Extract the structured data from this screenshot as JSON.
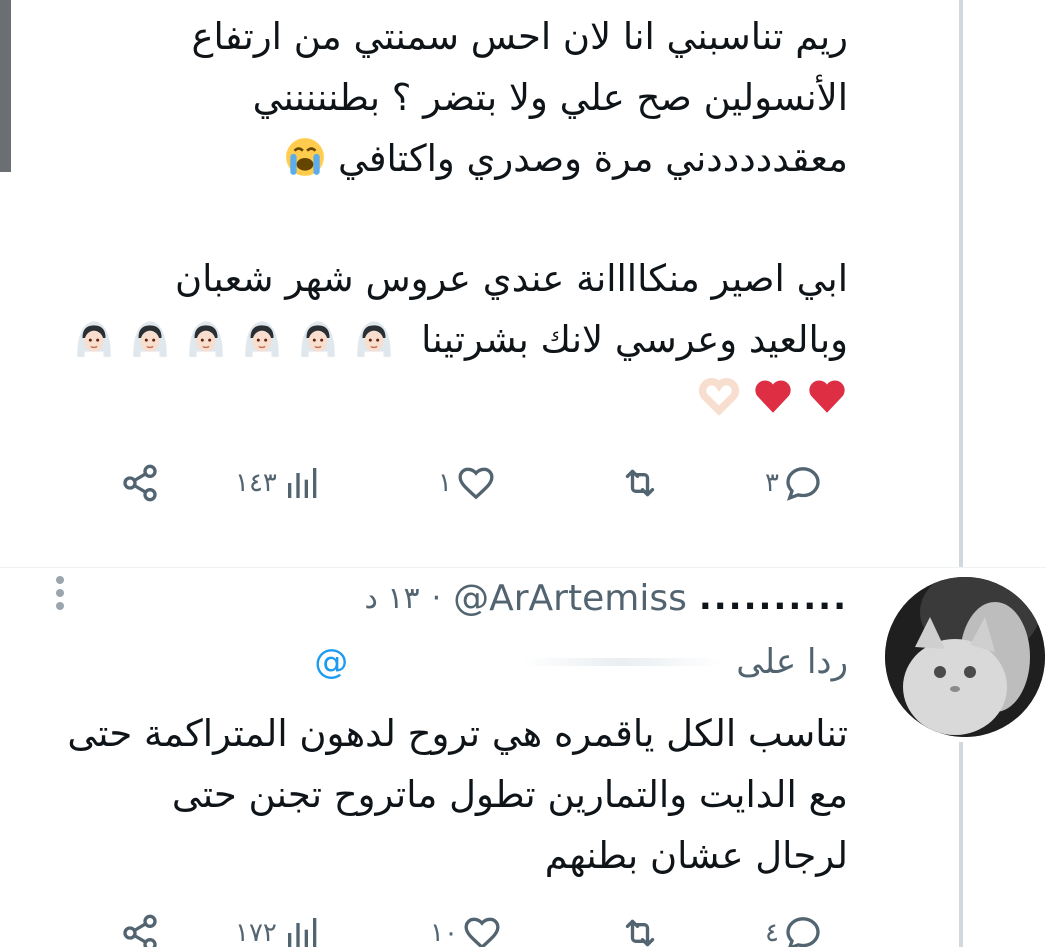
{
  "tweet1": {
    "lines": [
      "ريم تناسبني انا لان احس سمنتي من ارتفاع",
      "الأنسولين صح علي ولا بتضر ؟ بطننننني",
      "معقدددددني مرة وصدري واكتافي",
      "ابي اصير منكاااانة عندي عروس شهر شعبان",
      "وبالعيد وعرسي لانك بشرتينا"
    ],
    "emoji_line3": "loudly-crying-face",
    "emoji_line5": [
      "bride-with-veil",
      "bride-with-veil",
      "bride-with-veil",
      "bride-with-veil",
      "bride-with-veil",
      "bride-with-veil"
    ],
    "emoji_line6": [
      "red-heart",
      "red-heart",
      "heart-hands"
    ],
    "actions": {
      "replies": "٣",
      "retweets": "",
      "likes": "١",
      "views": "١٤٣"
    }
  },
  "tweet2": {
    "name": "..........",
    "handle": "@ArArtemiss",
    "time": "١٣ د",
    "separator": "·",
    "reply_label": "ردا على",
    "reply_handle": "@",
    "lines": [
      "تناسب الكل ياقمره هي تروح لدهون المتراكمة حتى",
      "مع الدايت والتمارين تطول ماتروح تجنن حتى",
      "لرجال عشان بطنهم"
    ],
    "actions": {
      "replies": "٤",
      "retweets": "",
      "likes": "١٠",
      "views": "١٧٢"
    }
  },
  "colors": {
    "text": "#0f1419",
    "muted": "#536471",
    "accent": "#1d9bf0",
    "thread_line": "#cfd9de"
  },
  "icons": [
    "reply-icon",
    "retweet-icon",
    "like-icon",
    "views-icon",
    "share-icon",
    "more-icon"
  ]
}
